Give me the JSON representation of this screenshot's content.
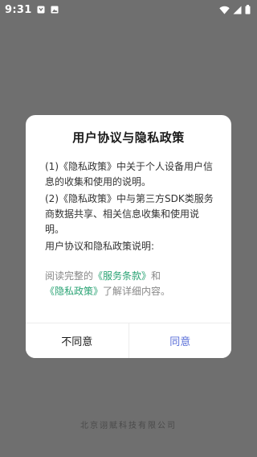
{
  "status_bar": {
    "time": "9:31",
    "left_icons": [
      "notification-icon",
      "image-icon"
    ],
    "right_icons": [
      "wifi-icon",
      "signal-icon",
      "battery-icon"
    ]
  },
  "dialog": {
    "title": "用户协议与隐私政策",
    "paragraphs": [
      "(1)《隐私政策》中关于个人设备用户信息的收集和使用的说明。",
      "(2)《隐私政策》中与第三方SDK类服务商数据共享、相关信息收集和使用说明。",
      "用户协议和隐私政策说明:"
    ],
    "consent": {
      "prefix": "阅读完整的",
      "terms_link": "《服务条款》",
      "and": "和",
      "privacy_link": "《隐私政策》",
      "suffix": "了解详细内容。"
    },
    "buttons": {
      "disagree": "不同意",
      "agree": "同意"
    },
    "colors": {
      "link": "#2aa374",
      "agree": "#5a6fd8"
    }
  },
  "footer": {
    "company": "北京诩赋科技有限公司"
  }
}
